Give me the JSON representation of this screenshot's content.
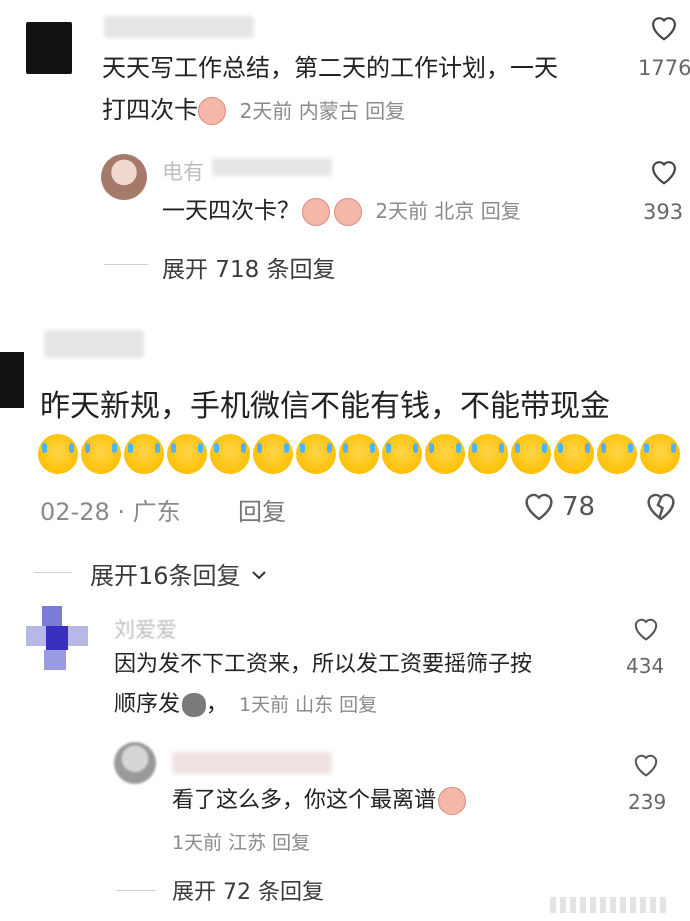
{
  "comments": [
    {
      "text_line1": "天天写工作总结，第二天的工作计划，一天",
      "text_line2": "打四次卡",
      "meta": "2天前 内蒙古 回复",
      "likes": "1776",
      "reply": {
        "name": "电有",
        "text": "一天四次卡？",
        "meta": "2天前 北京 回复",
        "likes": "393"
      },
      "expand": "展开 718 条回复"
    },
    {
      "text": "昨天新规，手机微信不能有钱，不能带现金",
      "meta_date": "02-28 · 广东",
      "meta_reply": "回复",
      "likes": "78",
      "expand": "展开16条回复"
    },
    {
      "name": "刘爱爱",
      "text_line1": "因为发不下工资来，所以发工资要摇筛子按",
      "text_line2": "顺序发",
      "meta": "1天前 山东 回复",
      "likes": "434",
      "reply": {
        "text": "看了这么多，你这个最离谱",
        "meta": "1天前 江苏 回复",
        "likes": "239"
      },
      "expand": "展开 72 条回复"
    }
  ],
  "colors": {
    "text": "#222222",
    "meta": "#8a8a8a",
    "divider": "#cfcfcf",
    "emoji_yellow": "#ffc107"
  },
  "icons": [
    "heart-icon",
    "broken-heart-icon",
    "chevron-down-icon"
  ]
}
